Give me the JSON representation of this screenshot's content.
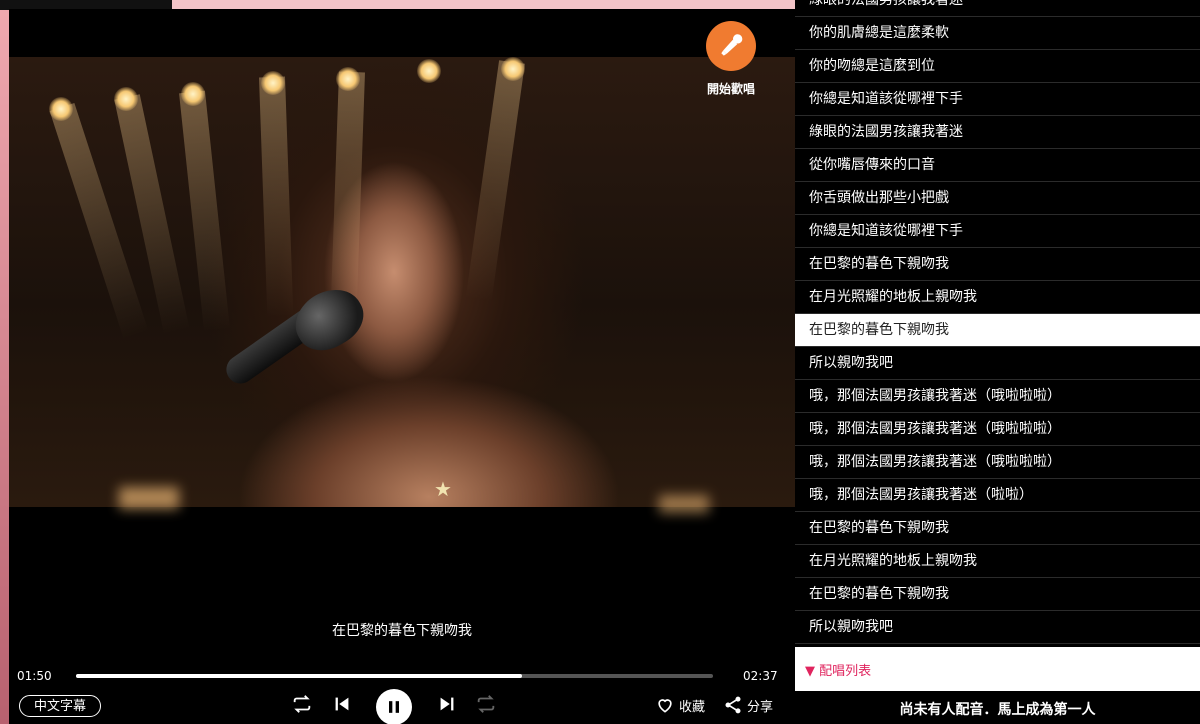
{
  "player": {
    "sing_label": "開始歡唱",
    "subtitle": "在巴黎的暮色下親吻我",
    "time_current": "01:50",
    "time_total": "02:37",
    "progress_fraction": 0.7,
    "subtitle_toggle_label": "中文字幕",
    "favorite_label": "收藏",
    "share_label": "分享",
    "accent_color": "#f07b30"
  },
  "lyrics": [
    {
      "text": "綠眼的法國男孩讓我著迷",
      "active": false
    },
    {
      "text": "你的肌膚總是這麼柔軟",
      "active": false
    },
    {
      "text": "你的吻總是這麼到位",
      "active": false
    },
    {
      "text": "你總是知道該從哪裡下手",
      "active": false
    },
    {
      "text": "綠眼的法國男孩讓我著迷",
      "active": false
    },
    {
      "text": "從你嘴唇傳來的口音",
      "active": false
    },
    {
      "text": "你舌頭做出那些小把戲",
      "active": false
    },
    {
      "text": "你總是知道該從哪裡下手",
      "active": false
    },
    {
      "text": "在巴黎的暮色下親吻我",
      "active": false
    },
    {
      "text": "在月光照耀的地板上親吻我",
      "active": false
    },
    {
      "text": "在巴黎的暮色下親吻我",
      "active": true
    },
    {
      "text": "所以親吻我吧",
      "active": false
    },
    {
      "text": "哦，那個法國男孩讓我著迷（哦啦啦啦）",
      "active": false
    },
    {
      "text": "哦，那個法國男孩讓我著迷（哦啦啦啦）",
      "active": false
    },
    {
      "text": "哦，那個法國男孩讓我著迷（哦啦啦啦）",
      "active": false
    },
    {
      "text": "哦，那個法國男孩讓我著迷（啦啦）",
      "active": false
    },
    {
      "text": "在巴黎的暮色下親吻我",
      "active": false
    },
    {
      "text": "在月光照耀的地板上親吻我",
      "active": false
    },
    {
      "text": "在巴黎的暮色下親吻我",
      "active": false
    },
    {
      "text": "所以親吻我吧",
      "active": false
    }
  ],
  "cover_list": {
    "header_label": "▼ 配唱列表",
    "header_color": "#e0245e",
    "empty_message": "尚未有人配音．馬上成為第一人"
  }
}
